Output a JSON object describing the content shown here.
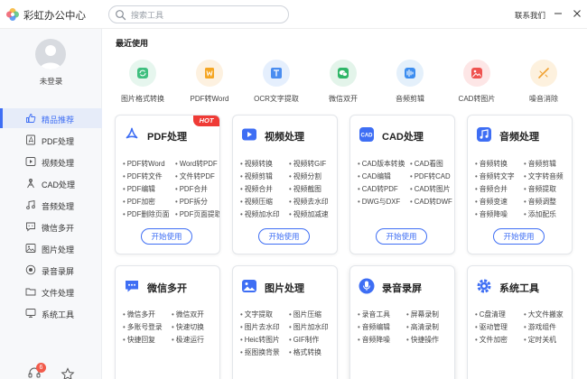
{
  "app": {
    "title": "彩虹办公中心"
  },
  "search": {
    "placeholder": "搜索工具"
  },
  "header": {
    "contact": "联系我们"
  },
  "user": {
    "status": "未登录"
  },
  "sidebar": {
    "items": [
      {
        "label": "精品推荐",
        "icon": "thumbs-up-icon",
        "active": true
      },
      {
        "label": "PDF处理",
        "icon": "pdf-icon"
      },
      {
        "label": "视频处理",
        "icon": "video-icon"
      },
      {
        "label": "CAD处理",
        "icon": "cad-icon"
      },
      {
        "label": "音频处理",
        "icon": "music-icon"
      },
      {
        "label": "微信多开",
        "icon": "chat-icon"
      },
      {
        "label": "图片处理",
        "icon": "image-icon"
      },
      {
        "label": "录音录屏",
        "icon": "record-icon"
      },
      {
        "label": "文件处理",
        "icon": "folder-icon"
      },
      {
        "label": "系统工具",
        "icon": "system-icon"
      }
    ],
    "badge": "6"
  },
  "recent": {
    "title": "最近使用",
    "items": [
      {
        "label": "图片格式转换",
        "icon": "image-convert-icon",
        "color": "#e6f6ee"
      },
      {
        "label": "PDF转Word",
        "icon": "word-icon",
        "color": "#fdf1e0"
      },
      {
        "label": "OCR文字提取",
        "icon": "ocr-icon",
        "color": "#e5effd"
      },
      {
        "label": "微信双开",
        "icon": "wechat-icon",
        "color": "#e3f4ea"
      },
      {
        "label": "音频剪辑",
        "icon": "audio-cut-icon",
        "color": "#e4f0fb"
      },
      {
        "label": "CAD转图片",
        "icon": "cad-image-icon",
        "color": "#fde6e6"
      },
      {
        "label": "噪音消除",
        "icon": "noise-icon",
        "color": "#fdf1de"
      }
    ]
  },
  "cards": [
    {
      "title": "PDF处理",
      "hot": "HOT",
      "button": "开始使用",
      "features": [
        "PDF转Word",
        "Word转PDF",
        "PDF转文件",
        "文件转PDF",
        "PDF编辑",
        "PDF合并",
        "PDF加密",
        "PDF拆分",
        "PDF删除页面",
        "PDF页面提取"
      ]
    },
    {
      "title": "视频处理",
      "button": "开始使用",
      "features": [
        "视频转换",
        "视频转GIF",
        "视频剪辑",
        "视频分割",
        "视频合并",
        "视频截图",
        "视频压缩",
        "视频去水印",
        "视频加水印",
        "视频加减速"
      ]
    },
    {
      "title": "CAD处理",
      "button": "开始使用",
      "features": [
        "CAD版本转换",
        "CAD看图",
        "CAD编辑",
        "PDF转CAD",
        "CAD转PDF",
        "CAD转图片",
        "DWG与DXF",
        "CAD转DWF"
      ]
    },
    {
      "title": "音频处理",
      "button": "开始使用",
      "features": [
        "音频转换",
        "音频剪辑",
        "音频转文字",
        "文字转音频",
        "音频合并",
        "音频提取",
        "音频变速",
        "音频调整",
        "音频降噪",
        "添加配乐"
      ]
    },
    {
      "title": "微信多开",
      "features": [
        "微信多开",
        "微信双开",
        "多账号登录",
        "快速切换",
        "快捷回复",
        "极速运行"
      ]
    },
    {
      "title": "图片处理",
      "features": [
        "文字提取",
        "图片压缩",
        "图片去水印",
        "图片加水印",
        "Heic转图片",
        "GIF制作",
        "抠图换背景",
        "格式转换"
      ]
    },
    {
      "title": "录音录屏",
      "features": [
        "录音工具",
        "屏幕录制",
        "音频编辑",
        "高清录制",
        "音频降噪",
        "快捷操作"
      ]
    },
    {
      "title": "系统工具",
      "features": [
        "C盘清理",
        "大文件搬家",
        "驱动管理",
        "游戏组件",
        "文件加密",
        "定时关机"
      ]
    }
  ]
}
